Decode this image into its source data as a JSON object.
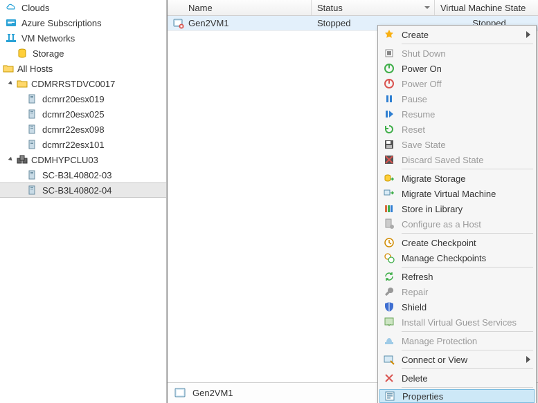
{
  "sidebar": {
    "clouds": "Clouds",
    "azure": "Azure Subscriptions",
    "vmnetworks": "VM Networks",
    "storage": "Storage",
    "allhosts": "All Hosts",
    "cluster1": {
      "name": "CDMRRSTDVC0017",
      "hosts": [
        "dcmrr20esx019",
        "dcmrr20esx025",
        "dcmrr22esx098",
        "dcmrr22esx101"
      ]
    },
    "cluster2": {
      "name": "CDMHYPCLU03",
      "hosts": [
        "SC-B3L40802-03",
        "SC-B3L40802-04"
      ]
    }
  },
  "columns": {
    "name": "Name",
    "status": "Status",
    "vmstate": "Virtual Machine State"
  },
  "vm": {
    "name": "Gen2VM1",
    "status": "Stopped",
    "state": "Stopped"
  },
  "details": {
    "label": "Gen2VM1"
  },
  "menu": {
    "create": "Create",
    "shutdown": "Shut Down",
    "poweron": "Power On",
    "poweroff": "Power Off",
    "pause": "Pause",
    "resume": "Resume",
    "reset": "Reset",
    "savestate": "Save State",
    "discard": "Discard Saved State",
    "migratestorage": "Migrate Storage",
    "migratevm": "Migrate Virtual Machine",
    "storelib": "Store in Library",
    "cfghost": "Configure as a Host",
    "createcheckpoint": "Create Checkpoint",
    "managecheckpoints": "Manage Checkpoints",
    "refresh": "Refresh",
    "repair": "Repair",
    "shield": "Shield",
    "installguest": "Install Virtual Guest Services",
    "manageprotection": "Manage Protection",
    "connect": "Connect or View",
    "delete": "Delete",
    "properties": "Properties"
  }
}
